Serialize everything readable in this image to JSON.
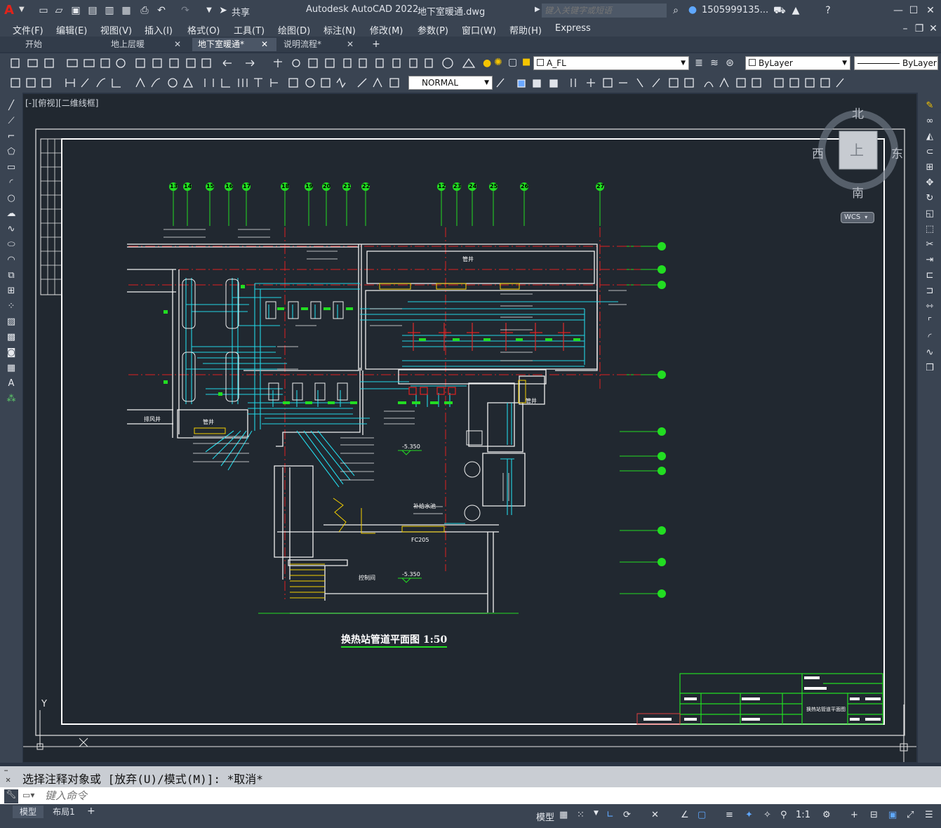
{
  "title_bar": {
    "app_title": "Autodesk AutoCAD 2022",
    "file_name": "地下室暖通.dwg",
    "share_label": "共享",
    "search_placeholder": "键入关键字或短语",
    "user_name": "1505999135..."
  },
  "menu": {
    "items": [
      "文件(F)",
      "编辑(E)",
      "视图(V)",
      "插入(I)",
      "格式(O)",
      "工具(T)",
      "绘图(D)",
      "标注(N)",
      "修改(M)",
      "参数(P)",
      "窗口(W)",
      "帮助(H)",
      "Express"
    ]
  },
  "doc_tabs": [
    {
      "label": "开始"
    },
    {
      "label": "地上层暖"
    },
    {
      "label": "地下室暖通*"
    },
    {
      "label": "说明流程*"
    }
  ],
  "toolbar": {
    "layer_name": "A_FL",
    "color_value": "ByLayer",
    "linetype_value": "ByLayer",
    "text_style": "NORMAL"
  },
  "viewport": {
    "label": "[-][俯视][二维线框]",
    "viewcube_north": "北",
    "viewcube_south": "南",
    "viewcube_east": "东",
    "viewcube_west": "西",
    "viewcube_face": "上",
    "wcs_label": "WCS",
    "ucs_y": "Y",
    "ucs_x": "X"
  },
  "drawing": {
    "title": "换热站管道平面图 1:50",
    "grid_top": [
      "13",
      "14",
      "15",
      "16",
      "17",
      "18",
      "19",
      "20",
      "21",
      "22",
      "12",
      "23",
      "24",
      "25",
      "26",
      "27"
    ],
    "room_labels": [
      "管井",
      "管井",
      "排风井",
      "管井",
      "控制间",
      "FC205",
      "补给水池"
    ],
    "elevations": [
      "-5.350",
      "-5.350"
    ],
    "title_block_name": "换热站管道平面图"
  },
  "command": {
    "history": "选择注释对象或 [放弃(U)/模式(M)]: *取消*",
    "placeholder": "键入命令"
  },
  "layout_tabs": [
    "模型",
    "布局1"
  ],
  "status": {
    "model_label": "模型",
    "scale": "1:1"
  }
}
